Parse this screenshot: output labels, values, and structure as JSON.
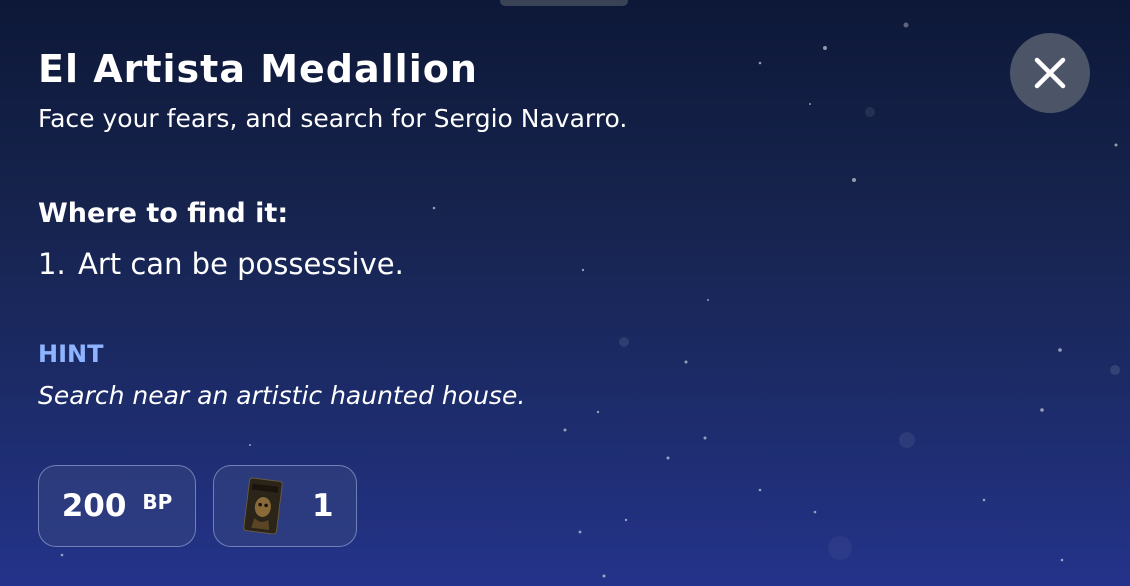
{
  "header": {
    "title": "El Artista Medallion",
    "subtitle": "Face your fears, and search for Sergio Navarro."
  },
  "close_button": {
    "icon": "close-icon"
  },
  "location": {
    "heading": "Where to find it:",
    "items": [
      {
        "number": "1.",
        "text": "Art can be possessive."
      }
    ]
  },
  "hint": {
    "label": "HINT",
    "text": "Search near an artistic haunted house."
  },
  "rewards": {
    "bp": {
      "value": "200",
      "unit": "BP"
    },
    "card": {
      "icon": "haunted-card-icon",
      "count": "1"
    }
  },
  "colors": {
    "background_top": "#0d1838",
    "background_bottom": "#24338a",
    "hint_accent": "#8fb4ff",
    "close_button_bg": "#4c5468"
  }
}
